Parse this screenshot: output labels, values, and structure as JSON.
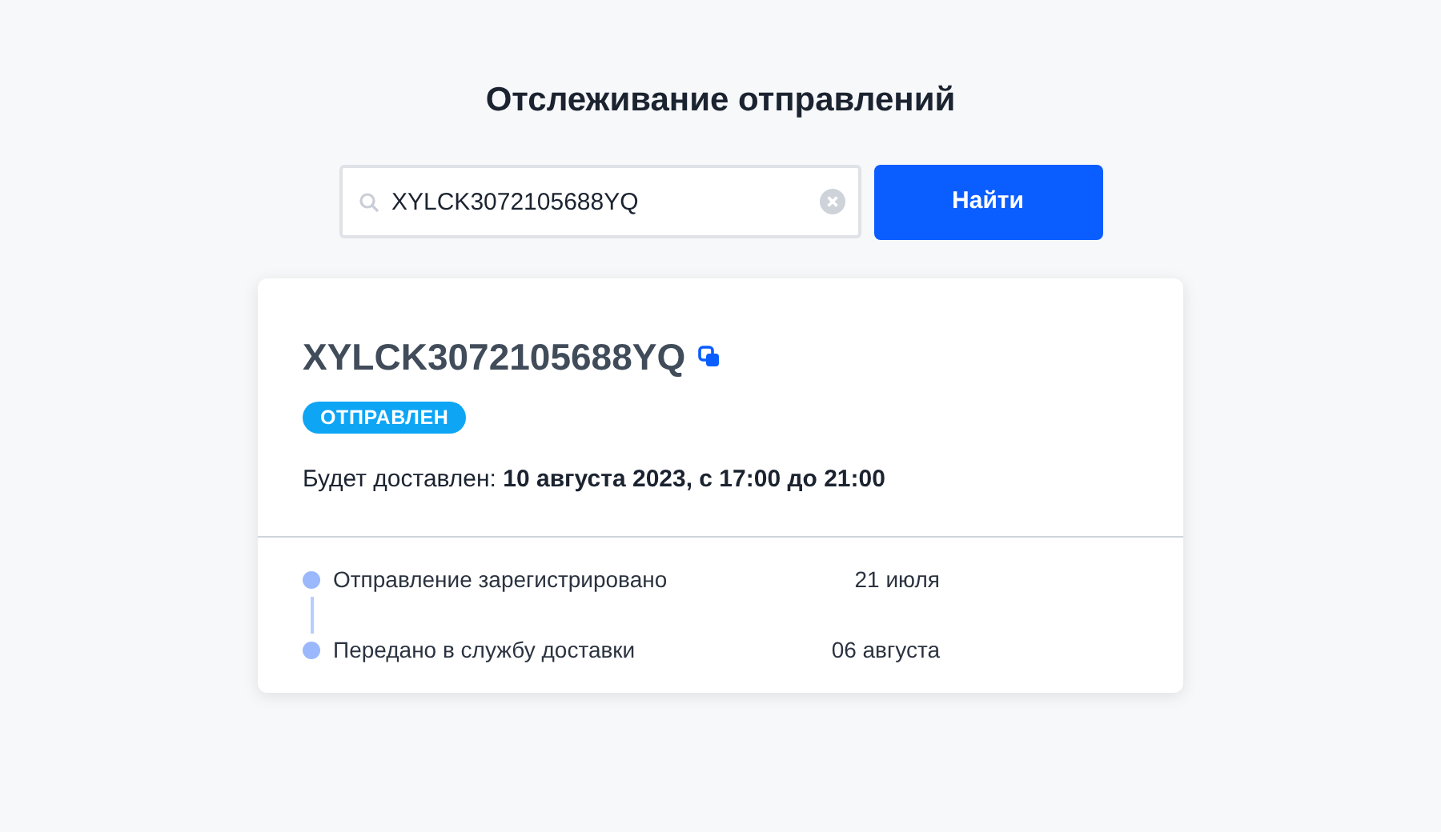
{
  "title": "Отслеживание отправлений",
  "search": {
    "value": "XYLCK3072105688YQ",
    "button": "Найти"
  },
  "shipment": {
    "tracking_number": "XYLCK3072105688YQ",
    "status": "ОТПРАВЛЕН",
    "delivery": "Будет доставлен: **10 августа 2023, с 17:00 до 21:00**",
    "events": [
      {
        "label": "Отправление зарегистрировано",
        "date": "21 июля"
      },
      {
        "label": "Передано в службу доставки",
        "date": "06 августа"
      }
    ]
  }
}
